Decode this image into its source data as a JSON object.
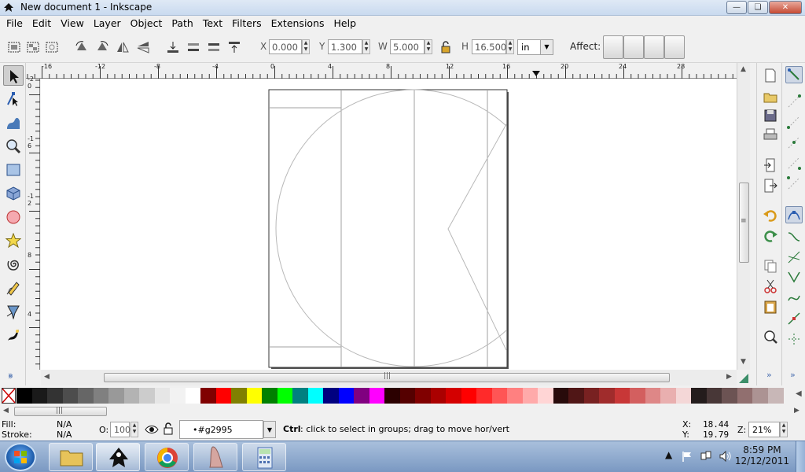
{
  "window": {
    "title": "New document 1 - Inkscape"
  },
  "menu": [
    "File",
    "Edit",
    "View",
    "Layer",
    "Object",
    "Path",
    "Text",
    "Filters",
    "Extensions",
    "Help"
  ],
  "tool_controls": {
    "x_label": "X",
    "x_value": "0.000",
    "y_label": "Y",
    "y_value": "1.300",
    "w_label": "W",
    "w_value": "5.000",
    "h_label": "H",
    "h_value": "16.500",
    "unit": "in",
    "affect_label": "Affect:"
  },
  "ruler_h_labels": [
    "-16",
    "-12",
    "-8",
    "-4",
    "0",
    "4",
    "8",
    "12",
    "16",
    "20",
    "24",
    "28"
  ],
  "ruler_v_labels": [
    "-2",
    "0",
    "-1",
    "6",
    "-1",
    "2",
    "8",
    "4"
  ],
  "palette_colors": [
    "#000000",
    "#1a1a1a",
    "#333333",
    "#4d4d4d",
    "#666666",
    "#808080",
    "#999999",
    "#b3b3b3",
    "#cccccc",
    "#e6e6e6",
    "#f2f2f2",
    "#ffffff",
    "#800000",
    "#ff0000",
    "#808000",
    "#ffff00",
    "#008000",
    "#00ff00",
    "#008080",
    "#00ffff",
    "#000080",
    "#0000ff",
    "#800080",
    "#ff00ff",
    "#2b0000",
    "#550000",
    "#800000",
    "#aa0000",
    "#d40000",
    "#ff0000",
    "#ff2a2a",
    "#ff5555",
    "#ff8080",
    "#ffaaaa",
    "#ffd5d5",
    "#280b0b",
    "#501616",
    "#782121",
    "#a02c2c",
    "#c83737",
    "#d35f5f",
    "#de8787",
    "#e9afaf",
    "#f4d7d7",
    "#241c1c",
    "#483737",
    "#6c5353",
    "#916f6f",
    "#ac9393",
    "#c8b7b7"
  ],
  "status": {
    "fill_label": "Fill:",
    "fill_value": "N/A",
    "stroke_label": "Stroke:",
    "stroke_value": "N/A",
    "opacity_label": "O:",
    "opacity_value": "100",
    "layer_value": "•#g2995",
    "message_bold": "Ctrl",
    "message": ": click to select in groups; drag to move hor/vert",
    "x_label": "X:",
    "x_value": "18.44",
    "y_label": "Y:",
    "y_value": "19.79",
    "zoom_label": "Z:",
    "zoom_value": "21%"
  },
  "taskbar": {
    "time": "8:59 PM",
    "date": "12/12/2011"
  },
  "colors": {
    "accent": "#4a6fb0",
    "titlebar": "#c9daef",
    "taskbar": "#7a98c2"
  }
}
